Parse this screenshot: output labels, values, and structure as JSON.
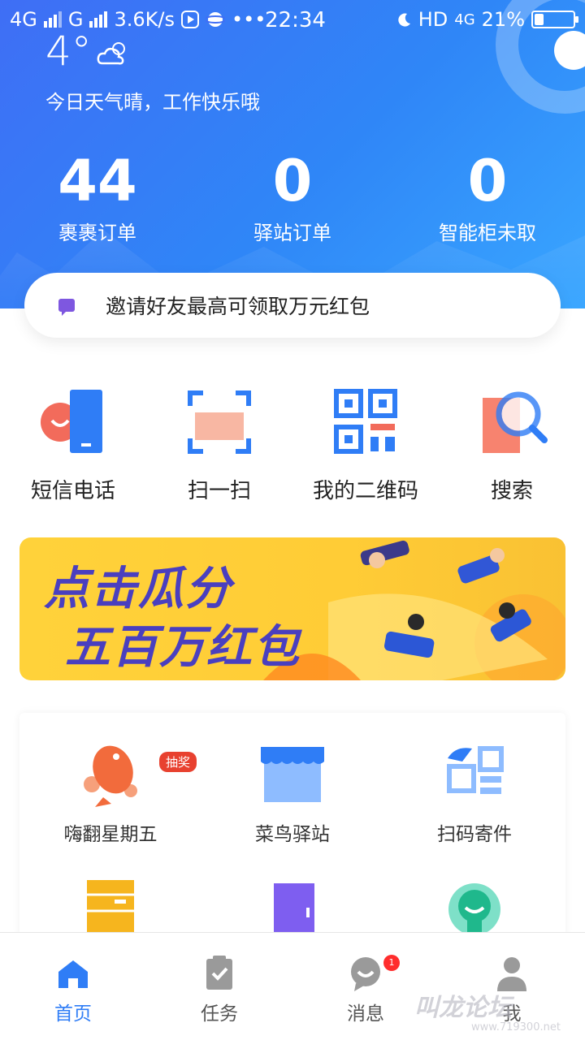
{
  "status_bar": {
    "network1": "4G",
    "network2": "G",
    "speed": "3.6K/s",
    "time": "22:34",
    "hd": "HD",
    "network3": "4G",
    "battery": "21%"
  },
  "weather": {
    "temperature": "4°",
    "greeting": "今日天气晴，工作快乐哦"
  },
  "stats": [
    {
      "value": "44",
      "label": "裹裹订单"
    },
    {
      "value": "0",
      "label": "驿站订单"
    },
    {
      "value": "0",
      "label": "智能柜未取"
    }
  ],
  "invite": {
    "text": "邀请好友最高可领取万元红包"
  },
  "quick_actions": [
    {
      "label": "短信电话",
      "icon": "phone-message-icon"
    },
    {
      "label": "扫一扫",
      "icon": "scan-icon"
    },
    {
      "label": "我的二维码",
      "icon": "qr-code-icon"
    },
    {
      "label": "搜索",
      "icon": "search-icon"
    }
  ],
  "banner": {
    "line1": "点击瓜分",
    "line2": "五百万红包"
  },
  "services": [
    {
      "label": "嗨翻星期五",
      "icon": "fish-icon",
      "badge": "抽奖"
    },
    {
      "label": "菜鸟驿站",
      "icon": "store-icon"
    },
    {
      "label": "扫码寄件",
      "icon": "scan-send-icon"
    }
  ],
  "services_row2": [
    {
      "icon": "locker-icon"
    },
    {
      "icon": "door-icon"
    },
    {
      "icon": "keyhole-icon"
    }
  ],
  "tabs": [
    {
      "label": "首页",
      "icon": "home-icon",
      "active": true
    },
    {
      "label": "任务",
      "icon": "task-icon"
    },
    {
      "label": "消息",
      "icon": "message-icon",
      "badge": "1"
    },
    {
      "label": "我",
      "icon": "user-icon"
    }
  ],
  "watermark": {
    "text": "叫龙论坛",
    "url": "www.719300.net"
  },
  "colors": {
    "primary": "#2f7df6",
    "header_start": "#3f6ef5",
    "banner_bg": "#ffcc36",
    "badge_red": "#e8412f"
  }
}
